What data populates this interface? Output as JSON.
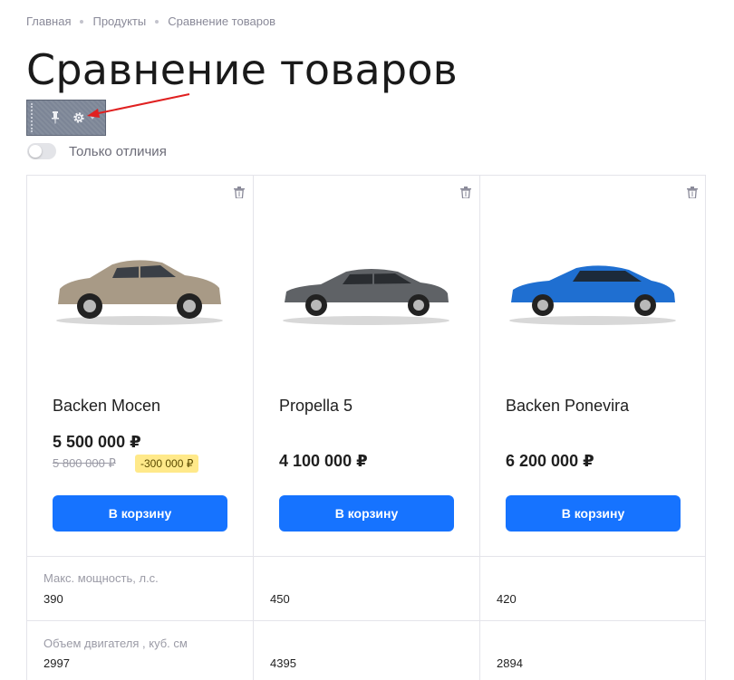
{
  "breadcrumb": [
    "Главная",
    "Продукты",
    "Сравнение товаров"
  ],
  "page_title": "Сравнение товаров",
  "edit_panel": {
    "icons": [
      "grip-icon",
      "pin-icon",
      "gear-icon",
      "chevron-down-icon"
    ]
  },
  "annotation": {
    "color": "#e02020"
  },
  "toggle": {
    "label": "Только отличия",
    "checked": false
  },
  "products": [
    {
      "name": "Backen Mocen",
      "price": "5 500 000 ₽",
      "old_price": "5 800 000 ₽",
      "discount": "-300 000 ₽",
      "button": "В корзину",
      "car_color": "#a89a86"
    },
    {
      "name": "Propella 5",
      "price": "4 100 000 ₽",
      "button": "В корзину",
      "car_color": "#5f6266"
    },
    {
      "name": "Backen Ponevira",
      "price": "6 200 000 ₽",
      "button": "В корзину",
      "car_color": "#1f6fd1"
    }
  ],
  "specs": [
    {
      "label": "Макс. мощность, л.с.",
      "values": [
        "390",
        "450",
        "420"
      ]
    },
    {
      "label": "Объем двигателя , куб. см",
      "values": [
        "2997",
        "4395",
        "2894"
      ]
    }
  ],
  "colors": {
    "accent": "#1673ff",
    "discount_bg": "#ffe98a"
  }
}
